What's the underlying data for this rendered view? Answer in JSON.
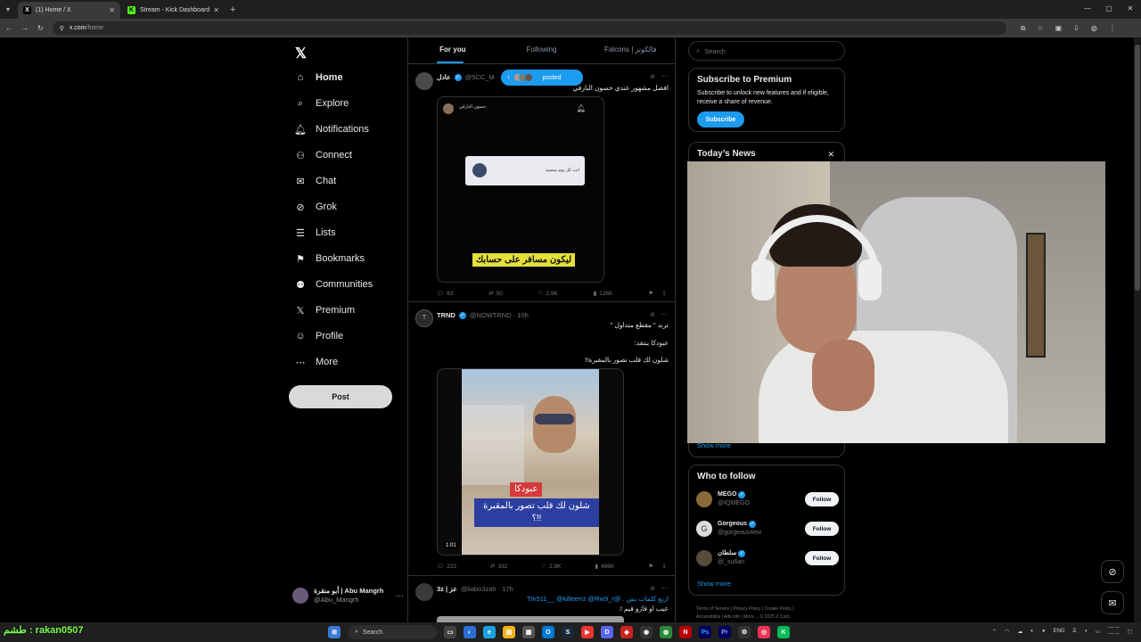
{
  "browser": {
    "tabs": [
      {
        "label": "(1) Home / X",
        "favicon": "x-icon",
        "active": true
      },
      {
        "label": "Stream - Kick Dashboard",
        "favicon": "kick-icon",
        "active": false
      }
    ],
    "url_host": "x.com",
    "url_path": "/home"
  },
  "nav": {
    "items": [
      {
        "label": "Home",
        "icon": "home-icon"
      },
      {
        "label": "Explore",
        "icon": "search-icon"
      },
      {
        "label": "Notifications",
        "icon": "bell-icon"
      },
      {
        "label": "Connect",
        "icon": "add-person-icon"
      },
      {
        "label": "Chat",
        "icon": "mail-icon"
      },
      {
        "label": "Grok",
        "icon": "grok-icon"
      },
      {
        "label": "Lists",
        "icon": "list-icon"
      },
      {
        "label": "Bookmarks",
        "icon": "bookmark-icon"
      },
      {
        "label": "Communities",
        "icon": "people-icon"
      },
      {
        "label": "Premium",
        "icon": "x-icon"
      },
      {
        "label": "Profile",
        "icon": "person-icon"
      },
      {
        "label": "More",
        "icon": "more-icon"
      }
    ],
    "post_label": "Post",
    "account": {
      "name": "أبو منقرة | Abu Mangrh",
      "handle": "@Abu_Mangrh"
    }
  },
  "timeline": {
    "tabs": [
      "For you",
      "Following",
      "Falcons | فالكونز"
    ],
    "posted_pill": "posted",
    "tweets": [
      {
        "name": "عادل",
        "handle": "@5CC_M · 12",
        "text": "افضل مشهور عندي حسون البارقي",
        "media_caption": "ليكون مسافر على حسابك",
        "media_header_name": "حسون البارقي",
        "media_card_text": "انت كل يوم بمسيه",
        "actions": {
          "replies": "83",
          "reposts": "50",
          "likes": "2.9K",
          "views": "126K"
        }
      },
      {
        "name": "TRND",
        "handle": "@NOWTRND · 10h",
        "text_lines": [
          "ترند \" مقطع متداول \"",
          "عبودكا ينتقد:",
          "شلون لك قلب تصور بالمقبرة!!"
        ],
        "media_caption_top": "عبودكا",
        "media_caption_bottom": "شلون لك قلب تصور بالمقبرة !!؟",
        "duration": "1:01",
        "actions": {
          "replies": "222",
          "reposts": "332",
          "likes": "2.9K",
          "views": "486K"
        }
      },
      {
        "name": "3z | عز",
        "handle": "@liabo3zah · 17h",
        "text_lines": [
          "اربع كلمات بس . @Trk511__ @killeerrz @Rw9_r",
          "عيب او فازو قيم !."
        ]
      }
    ]
  },
  "right": {
    "search_placeholder": "Search",
    "premium": {
      "title": "Subscribe to Premium",
      "body": "Subscribe to unlock new features and if eligible, receive a share of revenue.",
      "button": "Subscribe"
    },
    "news": {
      "title": "Today’s News",
      "show_more": "Show more"
    },
    "who_to_follow": {
      "title": "Who to follow",
      "users": [
        {
          "name": "MEGO",
          "handle": "@IQMEGO"
        },
        {
          "name": "Gorgeous",
          "handle": "@gorgeous4ew"
        },
        {
          "name": "سلطان",
          "handle": "@_su6an"
        }
      ],
      "follow_label": "Follow",
      "show_more": "Show more"
    },
    "footer": [
      "Terms of Service",
      "Privacy Policy",
      "Cookie Policy",
      "Accessibility",
      "Ads info",
      "More ...",
      "© 2025 X Corp."
    ]
  },
  "taskbar": {
    "overlay_text": "طشم : rakan0507",
    "search_label": "Search",
    "lang": "ENG"
  },
  "colors": {
    "accent": "#1d9bf0",
    "background": "#000000",
    "border": "#2f3336"
  }
}
